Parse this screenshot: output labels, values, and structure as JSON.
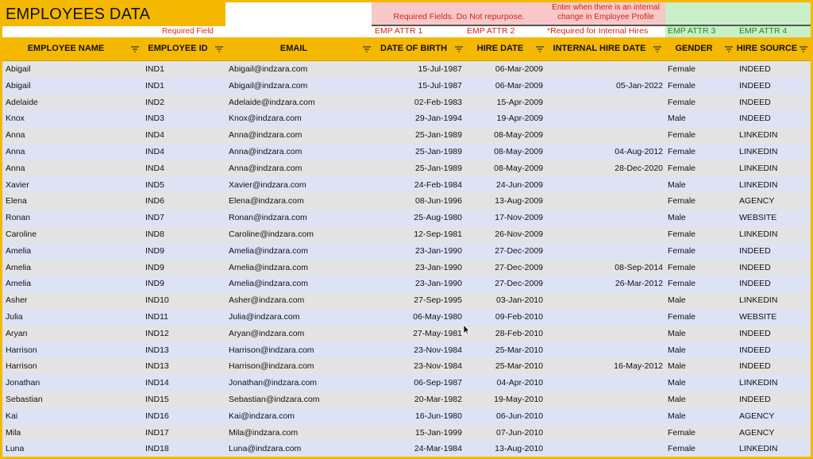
{
  "sheet": {
    "title": "EMPLOYEES DATA",
    "required_field_label": "Required Field",
    "required_fields_note": "Required Fields. Do Not repurpose.",
    "internal_change_note": "Enter when there is an internal change in Employee Profile",
    "internal_required_note": "*Required for Internal Hires",
    "attributes": [
      "EMP ATTR 1",
      "EMP ATTR 2",
      "EMP ATTR 3",
      "EMP ATTR 4"
    ]
  },
  "headers": [
    "EMPLOYEE NAME",
    "EMPLOYEE ID",
    "EMAIL",
    "DATE OF BIRTH",
    "HIRE DATE",
    "INTERNAL HIRE DATE",
    "GENDER",
    "HIRE SOURCE"
  ],
  "colors": {
    "header_bg": "#f5b800",
    "row_odd": "#e3e3e3",
    "row_even": "#dde3f5",
    "required_red": "#d0241c",
    "pink_bg": "#f8c8c8",
    "green_bg": "#c8efc8",
    "green_text": "#1f8a1f"
  },
  "rows": [
    [
      "Abigail",
      "IND1",
      "Abigail@indzara.com",
      "15-Jul-1987",
      "06-Mar-2009",
      "",
      "Female",
      "INDEED"
    ],
    [
      "Abigail",
      "IND1",
      "Abigail@indzara.com",
      "15-Jul-1987",
      "06-Mar-2009",
      "05-Jan-2022",
      "Female",
      "INDEED"
    ],
    [
      "Adelaide",
      "IND2",
      "Adelaide@indzara.com",
      "02-Feb-1983",
      "15-Apr-2009",
      "",
      "Female",
      "INDEED"
    ],
    [
      "Knox",
      "IND3",
      "Knox@indzara.com",
      "29-Jan-1994",
      "19-Apr-2009",
      "",
      "Male",
      "INDEED"
    ],
    [
      "Anna",
      "IND4",
      "Anna@indzara.com",
      "25-Jan-1989",
      "08-May-2009",
      "",
      "Female",
      "LINKEDIN"
    ],
    [
      "Anna",
      "IND4",
      "Anna@indzara.com",
      "25-Jan-1989",
      "08-May-2009",
      "04-Aug-2012",
      "Female",
      "LINKEDIN"
    ],
    [
      "Anna",
      "IND4",
      "Anna@indzara.com",
      "25-Jan-1989",
      "08-May-2009",
      "28-Dec-2020",
      "Female",
      "LINKEDIN"
    ],
    [
      "Xavier",
      "IND5",
      "Xavier@indzara.com",
      "24-Feb-1984",
      "24-Jun-2009",
      "",
      "Male",
      "LINKEDIN"
    ],
    [
      "Elena",
      "IND6",
      "Elena@indzara.com",
      "08-Jun-1996",
      "13-Aug-2009",
      "",
      "Female",
      "AGENCY"
    ],
    [
      "Ronan",
      "IND7",
      "Ronan@indzara.com",
      "25-Aug-1980",
      "17-Nov-2009",
      "",
      "Male",
      "WEBSITE"
    ],
    [
      "Caroline",
      "IND8",
      "Caroline@indzara.com",
      "12-Sep-1981",
      "26-Nov-2009",
      "",
      "Female",
      "LINKEDIN"
    ],
    [
      "Amelia",
      "IND9",
      "Amelia@indzara.com",
      "23-Jan-1990",
      "27-Dec-2009",
      "",
      "Female",
      "INDEED"
    ],
    [
      "Amelia",
      "IND9",
      "Amelia@indzara.com",
      "23-Jan-1990",
      "27-Dec-2009",
      "08-Sep-2014",
      "Female",
      "INDEED"
    ],
    [
      "Amelia",
      "IND9",
      "Amelia@indzara.com",
      "23-Jan-1990",
      "27-Dec-2009",
      "26-Mar-2012",
      "Female",
      "INDEED"
    ],
    [
      "Asher",
      "IND10",
      "Asher@indzara.com",
      "27-Sep-1995",
      "03-Jan-2010",
      "",
      "Male",
      "LINKEDIN"
    ],
    [
      "Julia",
      "IND11",
      "Julia@indzara.com",
      "06-May-1980",
      "09-Feb-2010",
      "",
      "Female",
      "WEBSITE"
    ],
    [
      "Aryan",
      "IND12",
      "Aryan@indzara.com",
      "27-May-1981",
      "28-Feb-2010",
      "",
      "Male",
      "INDEED"
    ],
    [
      "Harrison",
      "IND13",
      "Harrison@indzara.com",
      "23-Nov-1984",
      "25-Mar-2010",
      "",
      "Male",
      "INDEED"
    ],
    [
      "Harrison",
      "IND13",
      "Harrison@indzara.com",
      "23-Nov-1984",
      "25-Mar-2010",
      "16-May-2012",
      "Male",
      "INDEED"
    ],
    [
      "Jonathan",
      "IND14",
      "Jonathan@indzara.com",
      "06-Sep-1987",
      "04-Apr-2010",
      "",
      "Male",
      "LINKEDIN"
    ],
    [
      "Sebastian",
      "IND15",
      "Sebastian@indzara.com",
      "20-Mar-1982",
      "19-May-2010",
      "",
      "Male",
      "INDEED"
    ],
    [
      "Kai",
      "IND16",
      "Kai@indzara.com",
      "16-Jun-1980",
      "06-Jun-2010",
      "",
      "Male",
      "AGENCY"
    ],
    [
      "Mila",
      "IND17",
      "Mila@indzara.com",
      "15-Jan-1999",
      "07-Jun-2010",
      "",
      "Female",
      "AGENCY"
    ],
    [
      "Luna",
      "IND18",
      "Luna@indzara.com",
      "24-Mar-1984",
      "13-Aug-2010",
      "",
      "Female",
      "LINKEDIN"
    ]
  ]
}
